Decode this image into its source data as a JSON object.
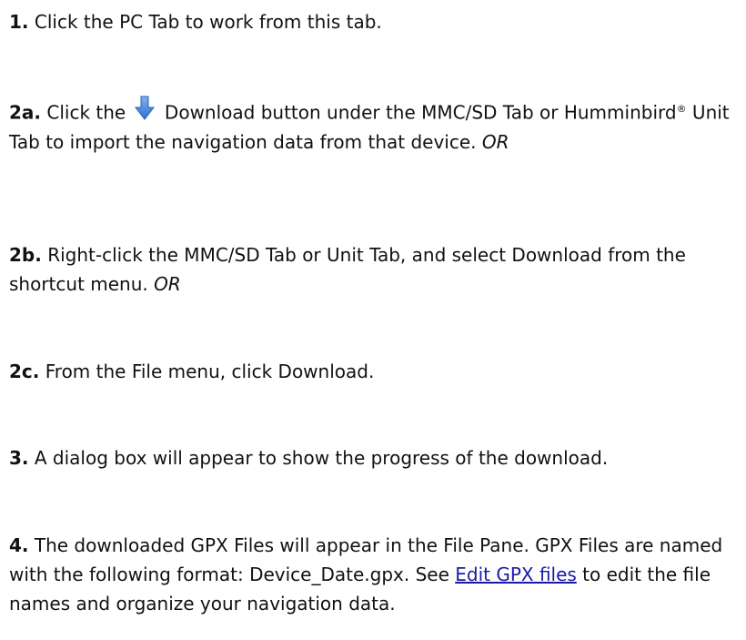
{
  "steps": {
    "s1": {
      "number": "1.",
      "text": " Click the PC Tab to work from this tab."
    },
    "s2a": {
      "number": "2a.",
      "text_before_icon": " Click the",
      "icon": "download-arrow-icon",
      "text_after_icon": " Download button under the MMC/SD Tab or Humminbird",
      "registered_mark": "®",
      "text_rest": " Unit Tab to import the navigation data from that device. ",
      "or": "OR"
    },
    "s2b": {
      "number": "2b.",
      "text": " Right-click the MMC/SD Tab or Unit Tab, and select Download from the shortcut menu. ",
      "or": "OR"
    },
    "s2c": {
      "number": "2c.",
      "text": " From the File menu, click Download."
    },
    "s3": {
      "number": "3.",
      "text": " A dialog box will appear to show the progress of the download."
    },
    "s4": {
      "number": "4.",
      "text_before_link": " The downloaded GPX Files will appear in the File Pane. GPX Files are named with the following format: Device_Date.gpx. See ",
      "link": "Edit GPX files",
      "text_after_link": " to edit the file names and organize your navigation data."
    }
  },
  "colors": {
    "text": "#111111",
    "link": "#1a1aa6",
    "icon_blue": "#3b7dd8"
  }
}
